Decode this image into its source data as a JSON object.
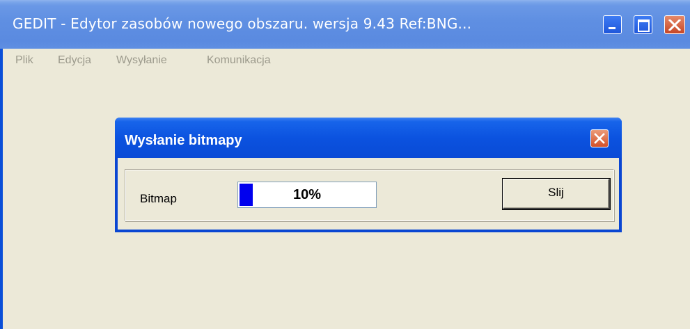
{
  "window": {
    "title": "GEDIT - Edytor zasobów nowego obszaru.   wersja  9.43 Ref:BNG...",
    "controls": [
      "minimize-icon",
      "maximize-icon",
      "close-icon"
    ]
  },
  "menu": {
    "items": [
      {
        "label": "Plik"
      },
      {
        "label": "Edycja"
      },
      {
        "label": "Wysyłanie"
      },
      {
        "label": "Komunikacja"
      }
    ]
  },
  "dialog": {
    "title": "Wysłanie bitmapy",
    "close_icon": "close-icon",
    "label": "Bitmap",
    "progress": {
      "value": 0.1,
      "text": "10%",
      "fill_color": "#0000ee"
    },
    "button_label": "Slij"
  },
  "colors": {
    "titlebar_blue": "#0a4ad6",
    "window_face": "#ece9d8",
    "close_red": "#d2502a",
    "menu_disabled_text": "#9c9a8c"
  }
}
